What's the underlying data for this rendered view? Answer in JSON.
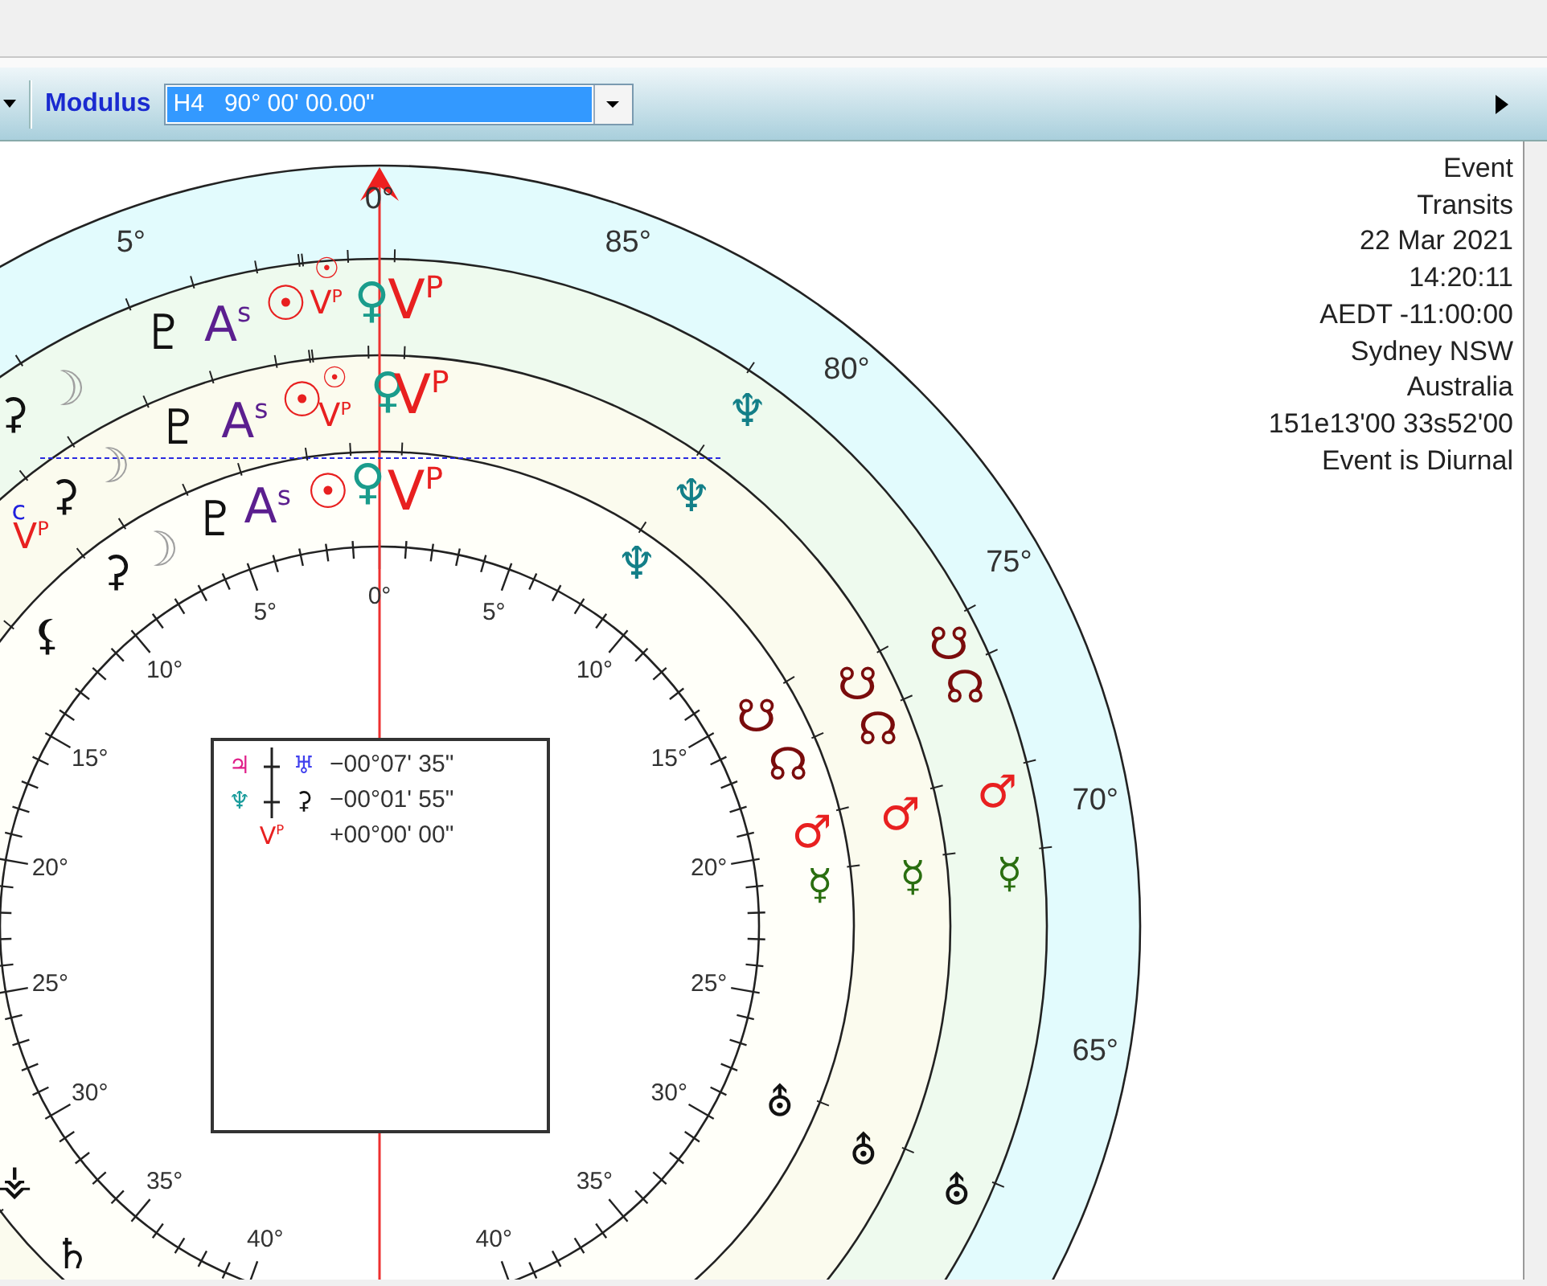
{
  "toolbar": {
    "label": "Modulus",
    "value": "H4   90° 00' 00.00\""
  },
  "event_info": [
    "Event",
    "Transits",
    "22 Mar 2021",
    "14:20:11",
    "AEDT -11:00:00",
    "Sydney NSW",
    "Australia",
    "151e13'00 33s52'00",
    "Event is Diurnal"
  ],
  "outer_scale": [
    "5°",
    "0°",
    "85°",
    "80°",
    "75°",
    "70°",
    "65°"
  ],
  "inner_scale": {
    "top": "0°",
    "right": [
      "5°",
      "10°",
      "15°",
      "20°",
      "25°",
      "30°",
      "35°",
      "40°"
    ],
    "left": [
      "5°",
      "10°",
      "15°",
      "20°",
      "25°",
      "30°",
      "35°",
      "40°"
    ]
  },
  "rings": [
    {
      "glyphs": [
        {
          "symbol": "⚳",
          "color": "#111111"
        },
        {
          "symbol": "☽",
          "color": "#a0a0a0"
        },
        {
          "symbol": "♇",
          "color": "#111111"
        },
        {
          "symbol": "A$^{s}$",
          "color": "#5b1f8f"
        },
        {
          "symbol": "☉",
          "color": "#e82020"
        },
        {
          "symbol": "☉",
          "color": "#e82020"
        },
        {
          "symbol": "V$^{P}$",
          "color": "#e82020"
        },
        {
          "symbol": "♀",
          "color": "#1a9c8c"
        },
        {
          "symbol": "V$^{P}$",
          "color": "#e82020"
        },
        {
          "symbol": "♆",
          "color": "#137f88"
        },
        {
          "symbol": "☋",
          "color": "#7a0c0c"
        },
        {
          "symbol": "☊",
          "color": "#7a0c0c"
        },
        {
          "symbol": "♂",
          "color": "#e82020"
        },
        {
          "symbol": "☿",
          "color": "#2a6e10"
        },
        {
          "symbol": "⛢",
          "color": "#111111"
        }
      ]
    },
    {
      "glyphs": [
        {
          "symbol": "⚳",
          "color": "#111111"
        },
        {
          "symbol": "☽",
          "color": "#a0a0a0"
        },
        {
          "symbol": "c",
          "color": "#2020dd"
        },
        {
          "symbol": "V$^{P}$",
          "color": "#e82020"
        },
        {
          "symbol": "♇",
          "color": "#111111"
        },
        {
          "symbol": "A$^{s}$",
          "color": "#5b1f8f"
        },
        {
          "symbol": "☉",
          "color": "#e82020"
        },
        {
          "symbol": "☉",
          "color": "#e82020"
        },
        {
          "symbol": "V$^{P}$",
          "color": "#e82020"
        },
        {
          "symbol": "♀",
          "color": "#1a9c8c"
        },
        {
          "symbol": "V$^{P}$",
          "color": "#e82020"
        },
        {
          "symbol": "♆",
          "color": "#137f88"
        },
        {
          "symbol": "☋",
          "color": "#7a0c0c"
        },
        {
          "symbol": "☊",
          "color": "#7a0c0c"
        },
        {
          "symbol": "♂",
          "color": "#e82020"
        },
        {
          "symbol": "☿",
          "color": "#2a6e10"
        },
        {
          "symbol": "⛢",
          "color": "#111111"
        }
      ]
    },
    {
      "glyphs": [
        {
          "symbol": "⚸",
          "color": "#111111"
        },
        {
          "symbol": "⚳",
          "color": "#111111"
        },
        {
          "symbol": "☽",
          "color": "#a0a0a0"
        },
        {
          "symbol": "♇",
          "color": "#111111"
        },
        {
          "symbol": "A$^{s}$",
          "color": "#5b1f8f"
        },
        {
          "symbol": "☉",
          "color": "#e82020"
        },
        {
          "symbol": "♀",
          "color": "#1a9c8c"
        },
        {
          "symbol": "V$^{P}$",
          "color": "#e82020"
        },
        {
          "symbol": "♆",
          "color": "#137f88"
        },
        {
          "symbol": "☋",
          "color": "#7a0c0c"
        },
        {
          "symbol": "☊",
          "color": "#7a0c0c"
        },
        {
          "symbol": "♂",
          "color": "#e82020"
        },
        {
          "symbol": "☿",
          "color": "#2a6e10"
        },
        {
          "symbol": "⛢",
          "color": "#111111"
        },
        {
          "symbol": "⚶",
          "color": "#111111"
        },
        {
          "symbol": "♄",
          "color": "#111111"
        }
      ]
    }
  ],
  "aspect_box": {
    "rows": [
      {
        "body_a": {
          "symbol": "♃",
          "color": "#e0208a"
        },
        "body_b": {
          "symbol": "♅",
          "color": "#4040ee"
        },
        "value": "−00°07' 35\""
      },
      {
        "body_a": {
          "symbol": "♆",
          "color": "#1a9c9c"
        },
        "body_b": {
          "symbol": "⚳",
          "color": "#111111"
        },
        "value": "−00°01' 55\""
      },
      {
        "body_a": {
          "symbol": "V$^{P}$",
          "color": "#e82020"
        },
        "value": "+00°00' 00\""
      }
    ]
  }
}
